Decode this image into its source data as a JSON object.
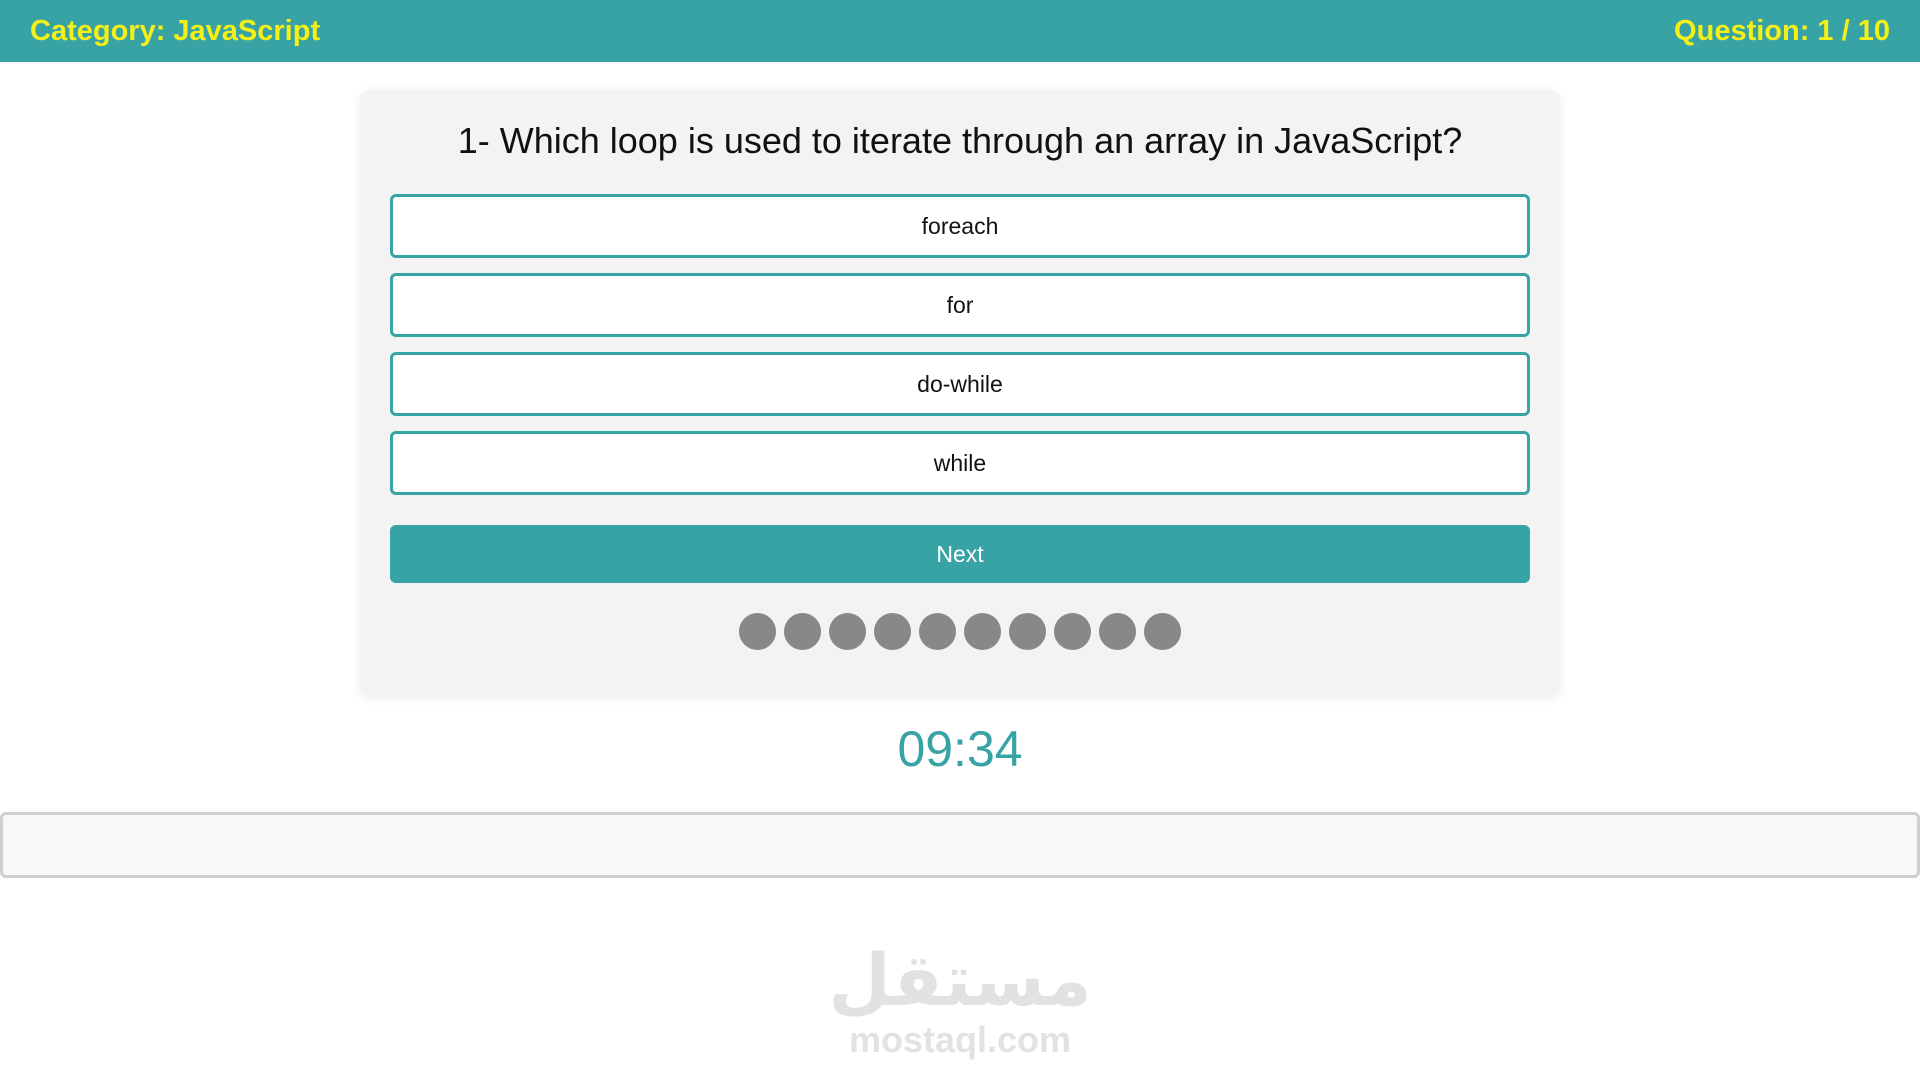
{
  "header": {
    "category": "Category: JavaScript",
    "question_counter": "Question: 1 / 10"
  },
  "quiz": {
    "question": "1- Which loop is used to iterate through an array in JavaScript?",
    "answers": [
      "foreach",
      "for",
      "do-while",
      "while"
    ],
    "next_label": "Next",
    "total_questions": 10,
    "answered": 0
  },
  "timer": "09:34",
  "watermark": {
    "logo": "مستقل",
    "url": "mostaql.com"
  },
  "colors": {
    "accent": "#38a3a5",
    "header_text": "#f4ef16",
    "bullet_inactive": "#888888"
  }
}
